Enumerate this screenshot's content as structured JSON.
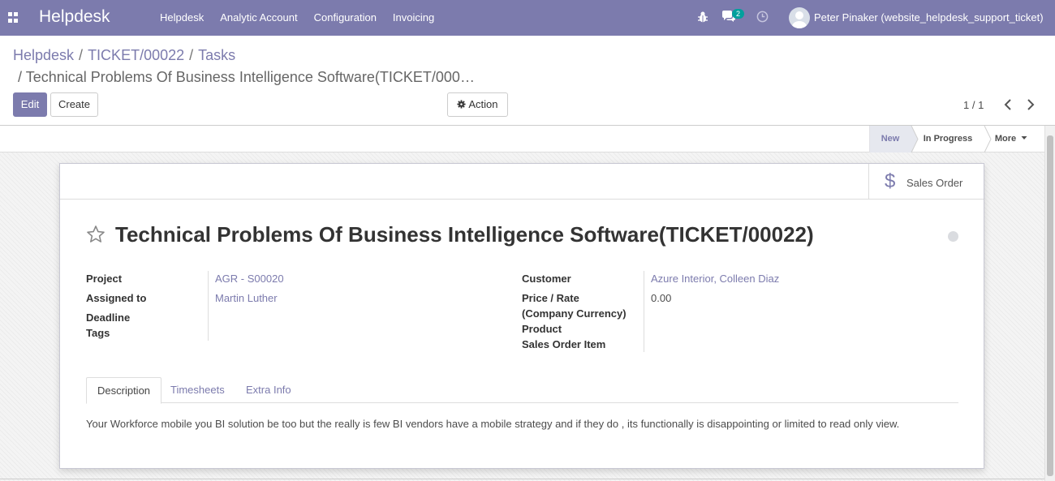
{
  "navbar": {
    "brand": "Helpdesk",
    "menu": [
      "Helpdesk",
      "Analytic Account",
      "Configuration",
      "Invoicing"
    ],
    "chat_badge": "2",
    "user": "Peter Pinaker (website_helpdesk_support_ticket)",
    "icons": [
      "apps-icon",
      "bug-icon",
      "chat-icon",
      "clock-icon",
      "avatar"
    ]
  },
  "breadcrumb": {
    "items": [
      "Helpdesk",
      "TICKET/00022",
      "Tasks"
    ],
    "separator": "/",
    "current": "Technical Problems Of Business Intelligence Software(TICKET/000…"
  },
  "buttons": {
    "edit": "Edit",
    "create": "Create",
    "action": "Action"
  },
  "pager": {
    "value": "1 / 1"
  },
  "statusbar": {
    "stages": [
      "New",
      "In Progress",
      "More"
    ],
    "active": "New"
  },
  "smart_buttons": {
    "sales_order": "Sales Order"
  },
  "record": {
    "title": "Technical Problems Of Business Intelligence Software(TICKET/00022)",
    "left_fields": {
      "project_label": "Project",
      "project_value": "AGR - S00020",
      "assigned_label": "Assigned to",
      "assigned_value": "Martin Luther",
      "deadline_label": "Deadline",
      "tags_label": "Tags"
    },
    "right_fields": {
      "customer_label": "Customer",
      "customer_value": "Azure Interior, Colleen Diaz",
      "price_label_1": "Price / Rate",
      "price_label_2": "(Company Currency)",
      "price_value": "0.00",
      "product_label": "Product",
      "soi_label": "Sales Order Item"
    }
  },
  "tabs": [
    "Description",
    "Timesheets",
    "Extra Info"
  ],
  "description": "Your Workforce mobile you BI solution be too but the really is few BI vendors have a mobile strategy and if they do , its functionally is disappointing or limited to read only view.",
  "colors": {
    "primary": "#7c7bad",
    "badge": "#00a09d",
    "text": "#4c4c4c"
  }
}
